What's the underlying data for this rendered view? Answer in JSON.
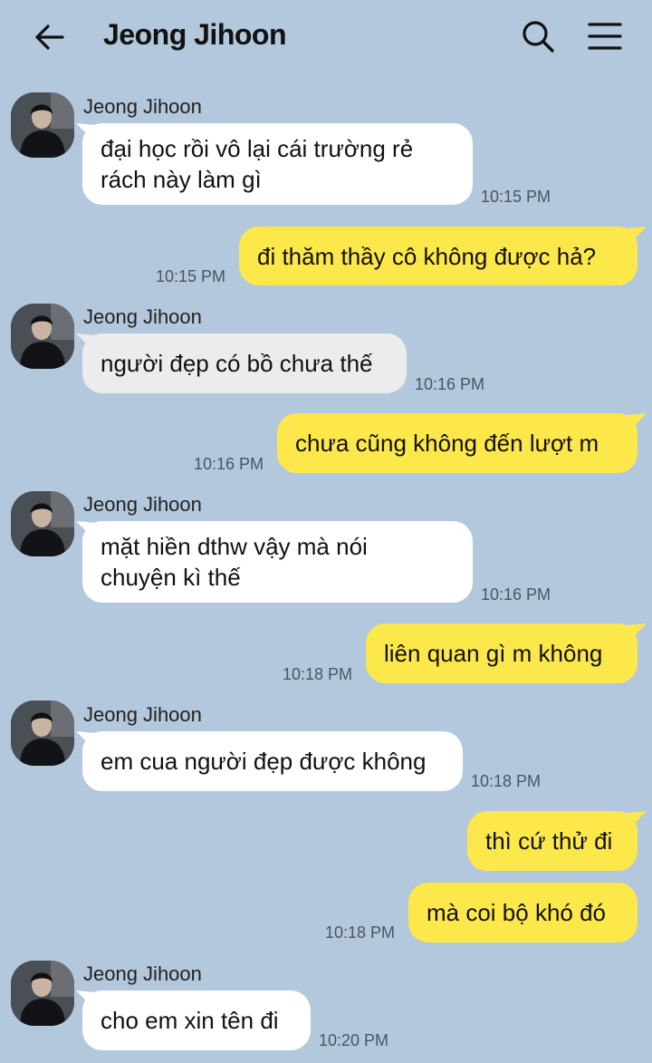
{
  "header": {
    "title": "Jeong Jihoon",
    "back_icon": "back-arrow-icon",
    "search_icon": "search-icon",
    "menu_icon": "menu-icon"
  },
  "colors": {
    "background": "#b3c8dc",
    "incoming_bubble": "#ffffff",
    "outgoing_bubble": "#fde84b",
    "time_text": "#4b5562"
  },
  "messages": [
    {
      "direction": "in",
      "sender": "Jeong Jihoon",
      "lines": [
        "đại học rồi vô lại cái trường rẻ",
        "rách này làm gì"
      ],
      "time": "10:15 PM"
    },
    {
      "direction": "out",
      "lines": [
        "đi thăm thầy cô không được hả?"
      ],
      "time": "10:15 PM"
    },
    {
      "direction": "in",
      "sender": "Jeong Jihoon",
      "lines": [
        "người đẹp có bồ chưa thế"
      ],
      "time": "10:16 PM"
    },
    {
      "direction": "out",
      "lines": [
        "chưa cũng không đến lượt m"
      ],
      "time": "10:16 PM"
    },
    {
      "direction": "in",
      "sender": "Jeong Jihoon",
      "lines": [
        "mặt hiền dthw vậy mà nói",
        "chuyện kì thế"
      ],
      "time": "10:16 PM"
    },
    {
      "direction": "out",
      "lines": [
        "liên quan gì m không"
      ],
      "time": "10:18 PM"
    },
    {
      "direction": "in",
      "sender": "Jeong Jihoon",
      "lines": [
        "em cua người đẹp được không"
      ],
      "time": "10:18 PM"
    },
    {
      "direction": "out",
      "lines": [
        "thì cứ thử đi"
      ]
    },
    {
      "direction": "out",
      "lines": [
        "mà coi bộ khó đó"
      ],
      "time": "10:18 PM"
    },
    {
      "direction": "in",
      "sender": "Jeong Jihoon",
      "lines": [
        "cho em xin tên đi"
      ],
      "time": "10:20 PM"
    }
  ]
}
